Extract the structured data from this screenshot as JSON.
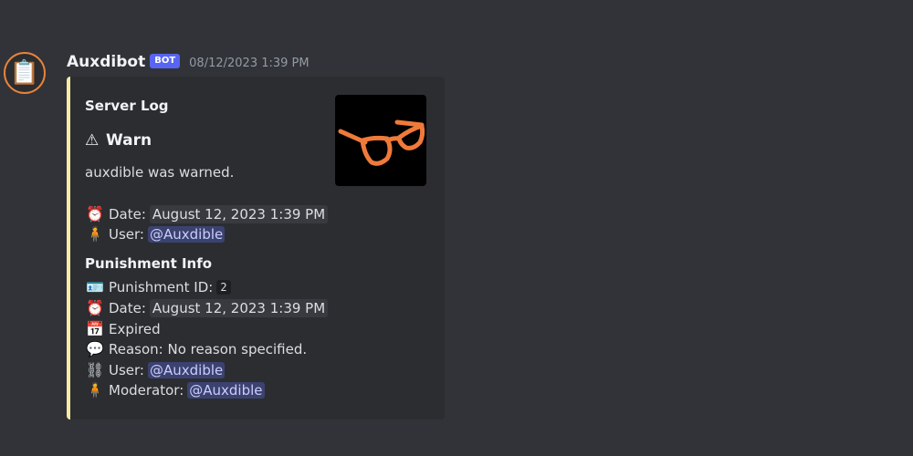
{
  "message": {
    "author": "Auxdibot",
    "bot_tag": "BOT",
    "timestamp": "08/12/2023 1:39 PM",
    "avatar_icon": "clipboard-icon"
  },
  "embed": {
    "accent_color": "#f8eba6",
    "author": "Server Log",
    "title_icon": "warning-icon",
    "title": "Warn",
    "description": "auxdible was warned.",
    "thumbnail_icon": "orange-glasses-icon",
    "top_fields": [
      {
        "icon": "alarm-clock-icon",
        "label": "Date:",
        "value": "August 12, 2023 1:39 PM"
      },
      {
        "icon": "person-icon",
        "label": "User:",
        "value": "@Auxdible"
      }
    ],
    "section_title": "Punishment Info",
    "punishment_fields": [
      {
        "icon": "id-card-icon",
        "label": "Punishment ID:",
        "value": "2"
      },
      {
        "icon": "alarm-clock-icon",
        "label": "Date:",
        "value": "August 12, 2023 1:39 PM"
      },
      {
        "icon": "calendar-icon",
        "label": "Expired"
      },
      {
        "icon": "speech-bubble-icon",
        "label": "Reason: No reason specified."
      },
      {
        "icon": "chains-icon",
        "label": "User:",
        "value": "@Auxdible"
      },
      {
        "icon": "person-icon",
        "label": "Moderator:",
        "value": "@Auxdible"
      }
    ]
  }
}
